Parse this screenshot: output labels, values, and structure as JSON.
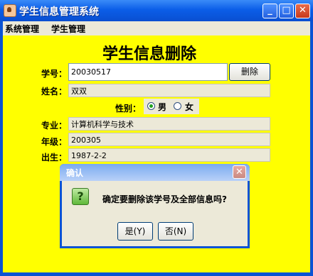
{
  "window": {
    "title": "学生信息管理系统",
    "minimize": "_",
    "maximize": "□",
    "close": "✕"
  },
  "menu": [
    "系统管理",
    "学生管理"
  ],
  "form": {
    "title": "学生信息删除",
    "student_id_label": "学号：",
    "student_id_value": "20030517",
    "delete_button": "删除",
    "name_label": "姓名：",
    "name_value": "双双",
    "gender_label": "性别：",
    "gender_options": [
      "男",
      "女"
    ],
    "gender_selected": "男",
    "major_label": "专业：",
    "major_value": "计算机科学与技术",
    "grade_label": "年级：",
    "grade_value": "200305",
    "birth_label": "出生：",
    "birth_value": "1987-2-2"
  },
  "dialog": {
    "title": "确认",
    "close": "✕",
    "icon": "question-icon",
    "icon_glyph": "?",
    "message": "确定要删除该学号及全部信息吗?",
    "yes_button": "是(Y)",
    "no_button": "否(N)"
  }
}
